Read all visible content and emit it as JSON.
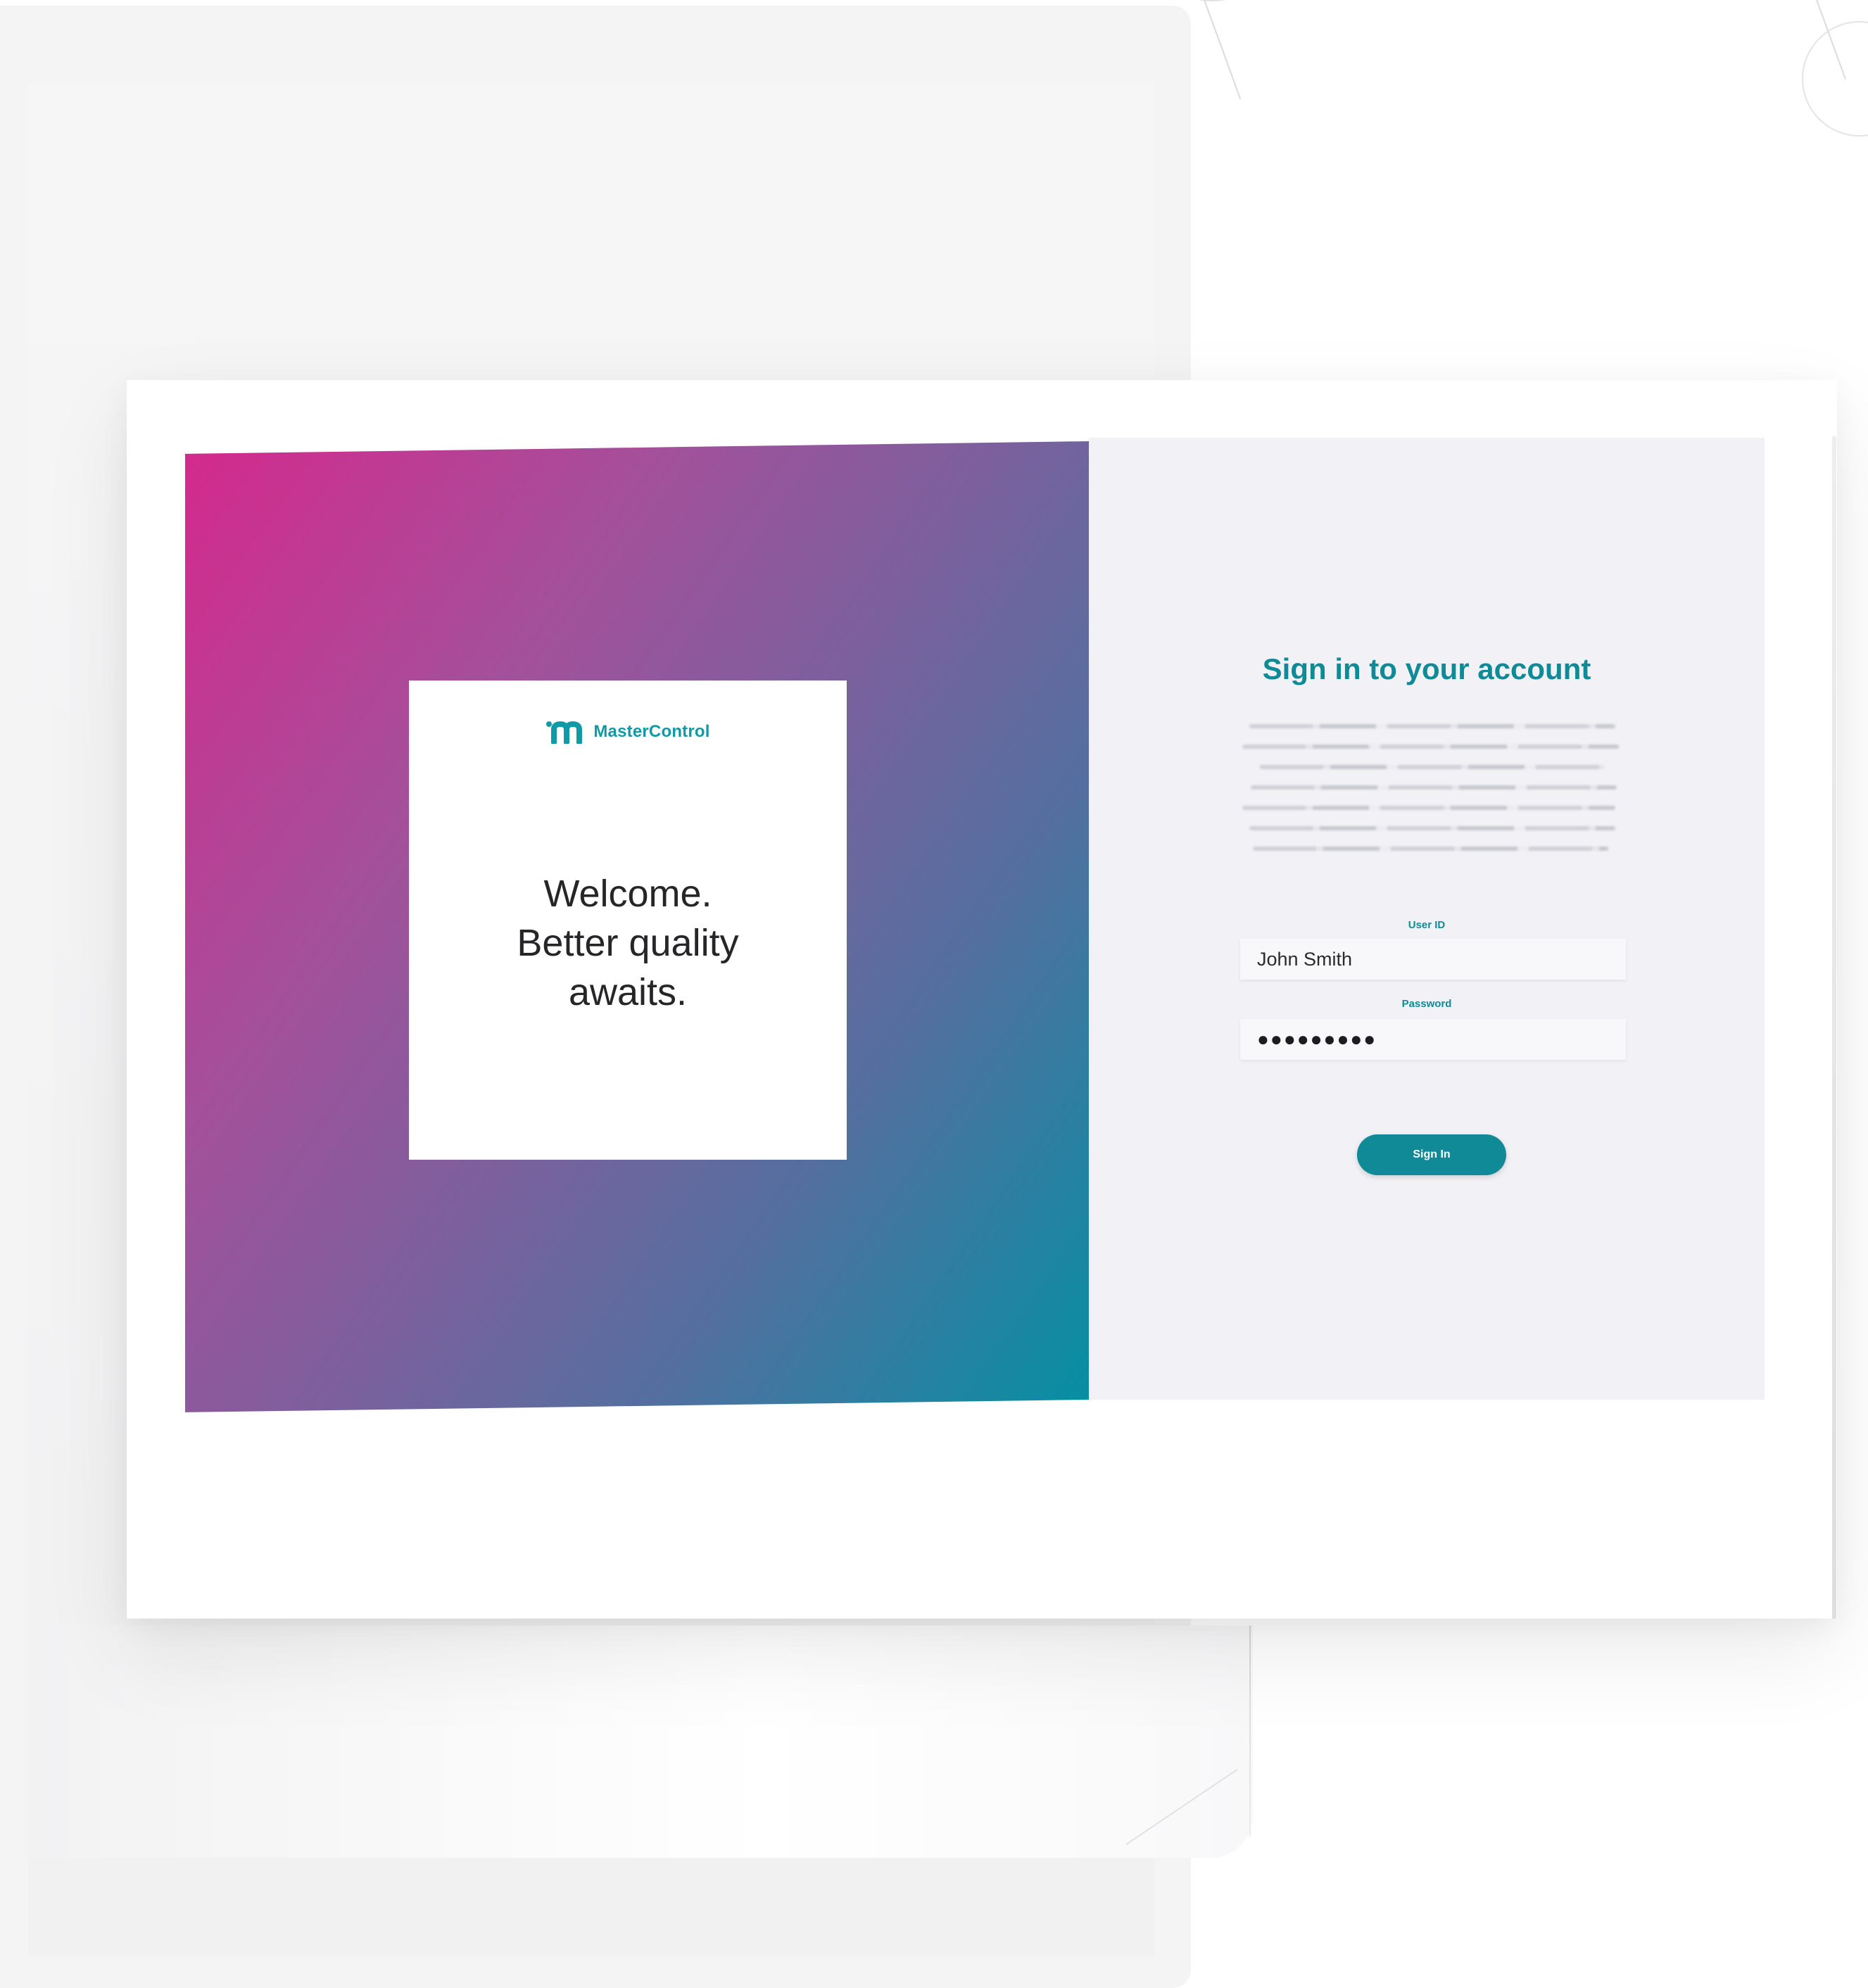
{
  "brand": {
    "name": "MasterControl",
    "icon": "mastercontrol-logo-icon",
    "color": "#0f9aa6"
  },
  "welcome": {
    "line1": "Welcome.",
    "line2": "Better quality",
    "line3": "awaits."
  },
  "signin": {
    "title": "Sign in to your account",
    "user_id_label": "User ID",
    "user_id_value": "John Smith",
    "password_label": "Password",
    "password_value": "●●●●●●●●●",
    "button_label": "Sign In"
  },
  "colors": {
    "accent": "#0e8b96",
    "gradient_start": "#d32a8d",
    "gradient_end": "#068fa3"
  }
}
